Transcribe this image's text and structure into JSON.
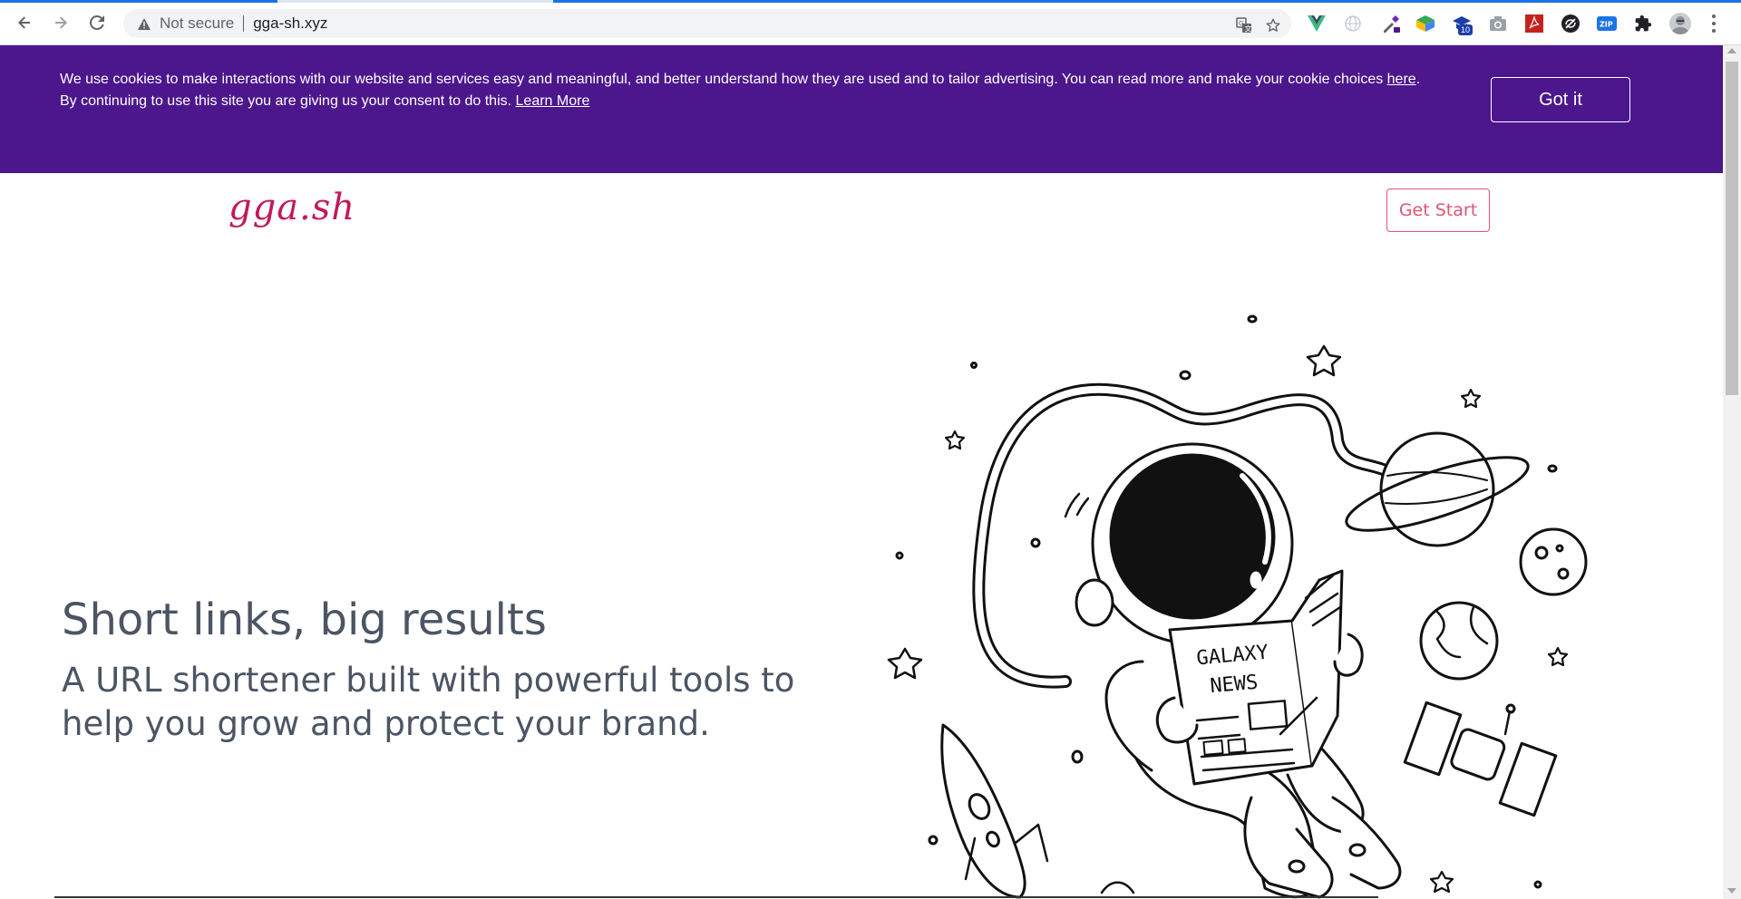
{
  "browser": {
    "security_label": "Not secure",
    "url": "gga-sh.xyz",
    "extension_badge": "10",
    "extensions": [
      "vue-devtools-icon",
      "globe-icon",
      "eyedropper-icon",
      "colorful-cube-icon",
      "graduation-cap-icon",
      "camera-icon",
      "pdf-icon",
      "refresh-circle-icon",
      "zip-icon",
      "puzzle-icon"
    ]
  },
  "cookie_banner": {
    "text_line1": "We use cookies to make interactions with our website and services easy and meaningful, and better understand how they are used and to tailor advertising. You can read more and make your cookie choices ",
    "here_link": "here",
    "text_line1_end": ".",
    "text_line2": "By continuing to use this site you are giving us your consent to do this. ",
    "learn_more": "Learn More",
    "button": "Got it",
    "bg_color": "#4c168c"
  },
  "site": {
    "logo": "gga.sh",
    "get_start": "Get Start",
    "hero_title": "Short links, big results",
    "hero_subtitle": "A URL shortener built with powerful tools to help you grow and protect your brand.",
    "newspaper_line1": "GALAXY",
    "newspaper_line2": "NEWS",
    "accent_color": "#c2185b"
  }
}
